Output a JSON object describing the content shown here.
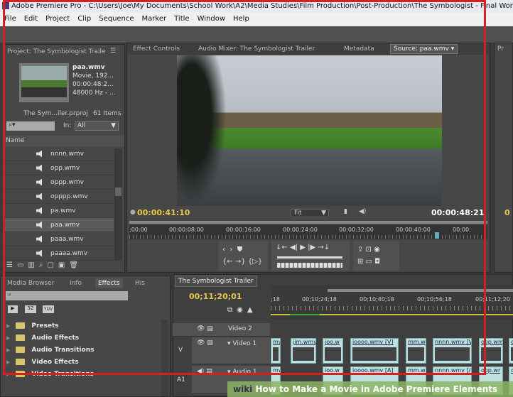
{
  "window": {
    "title": "Adobe Premiere Pro - C:\\Users\\Joe\\My Documents\\School Work\\A2\\Media Studies\\Film Production\\Post-Production\\The Symbologist - Final Work\\The Symb"
  },
  "menu": [
    "File",
    "Edit",
    "Project",
    "Clip",
    "Sequence",
    "Marker",
    "Title",
    "Window",
    "Help"
  ],
  "project": {
    "tab": "Project: The Symbologist Traile",
    "clip_name": "paa.wmv",
    "clip_info": [
      "Movie, 192...",
      "00:00:48:2...",
      "48000 Hz - ..."
    ],
    "file": "The Sym...iler.prproj",
    "count": "61 Items",
    "in_label": "In:",
    "in_value": "All",
    "col_name": "Name",
    "items": [
      {
        "name": "nnnn.wmv"
      },
      {
        "name": "opp.wmv"
      },
      {
        "name": "oppp.wmv"
      },
      {
        "name": "opppp.wmv"
      },
      {
        "name": "pa.wmv"
      },
      {
        "name": "paa.wmv",
        "selected": true
      },
      {
        "name": "paaa.wmv"
      },
      {
        "name": "paaaa.wmv"
      }
    ]
  },
  "monitor": {
    "tabs": [
      "Effect Controls",
      "Audio Mixer: The Symbologist Trailer",
      "Metadata"
    ],
    "source": "Source: paa.wmv",
    "current_tc": "00:00:41:10",
    "duration_tc": "00:00:48:21",
    "zoom": "Fit",
    "ruler": [
      ";00:00",
      "00:00:08:00",
      "00:00:16:00",
      "00:00:24:00",
      "00:00:32:00",
      "00:00:40:00",
      "00:00:"
    ],
    "playhead_fraction": 0.86,
    "right_panel_tab": "Pr",
    "right_tc": "0"
  },
  "effects": {
    "tabs": [
      "Media Browser",
      "Info",
      "Effects",
      "His"
    ],
    "badges": [
      "32",
      "YUV"
    ],
    "items": [
      "Presets",
      "Audio Effects",
      "Audio Transitions",
      "Video Effects",
      "Video Transitions"
    ]
  },
  "timeline": {
    "tab": "The Symbologist Trailer",
    "tc": "00;11;20;01",
    "ruler": [
      ";18",
      "00;10;24;18",
      "00;10;40;18",
      "00;10;56;18",
      "00;11;12;20"
    ],
    "tracks": {
      "v2": "Video 2",
      "v1": "Video 1",
      "a1": "Audio 1",
      "v": "V",
      "a": "A1"
    },
    "video_clips": [
      "mv [",
      "jim.wmv",
      "ioo.w",
      "ioooo.wmv [V]",
      "mm.w",
      "nnnn.wmv [V",
      "oop.wm",
      "o"
    ],
    "audio_clips": [
      "mv [",
      "ioo.w",
      "ioooo.wmv [A]",
      "mm.w",
      "nnnn.wmv [/",
      "oop.wr",
      "o"
    ]
  },
  "watermark": {
    "brand": "wiki",
    "text": "How to Make a Movie in Adobe Premiere Elements"
  },
  "colors": {
    "highlight": "#d42020",
    "timecode": "#e8c84a",
    "clip": "#bfe0de"
  }
}
